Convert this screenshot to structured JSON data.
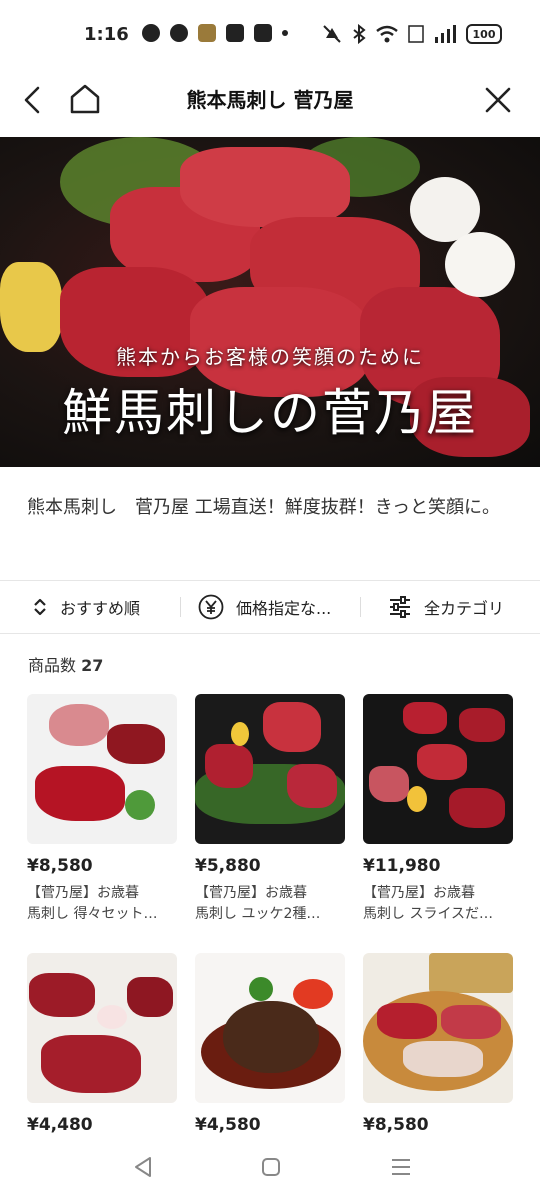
{
  "status_bar": {
    "time": "1:16",
    "battery": "100"
  },
  "header": {
    "title": "熊本馬刺し 菅乃屋"
  },
  "banner": {
    "subtitle": "熊本からお客様の笑顔のために",
    "title": "鮮馬刺しの菅乃屋"
  },
  "shop": {
    "description": "熊本馬刺し　菅乃屋 工場直送！鮮度抜群！きっと笑顔に。"
  },
  "filters": {
    "sort_label": "おすすめ順",
    "price_label": "価格指定な...",
    "category_label": "全カテゴリ"
  },
  "count": {
    "label": "商品数",
    "value": "27"
  },
  "products": [
    {
      "price": "¥8,580",
      "name": "【菅乃屋】お歳暮\n馬刺し 得々セット…"
    },
    {
      "price": "¥5,880",
      "name": "【菅乃屋】お歳暮\n馬刺し ユッケ2種…"
    },
    {
      "price": "¥11,980",
      "name": "【菅乃屋】お歳暮\n馬刺し スライスだ…"
    },
    {
      "price": "¥4,480",
      "name": ""
    },
    {
      "price": "¥4,580",
      "name": ""
    },
    {
      "price": "¥8,580",
      "name": ""
    }
  ],
  "colors": {
    "background": "#ffffff",
    "text": "#222222",
    "meat_red": "#b3202e",
    "banner_dark": "#141110"
  },
  "icons": [
    "back-icon",
    "home-icon",
    "close-icon",
    "sort-icon",
    "yen-icon",
    "filter-sliders-icon",
    "nav-back-icon",
    "nav-home-icon",
    "nav-recents-icon"
  ]
}
